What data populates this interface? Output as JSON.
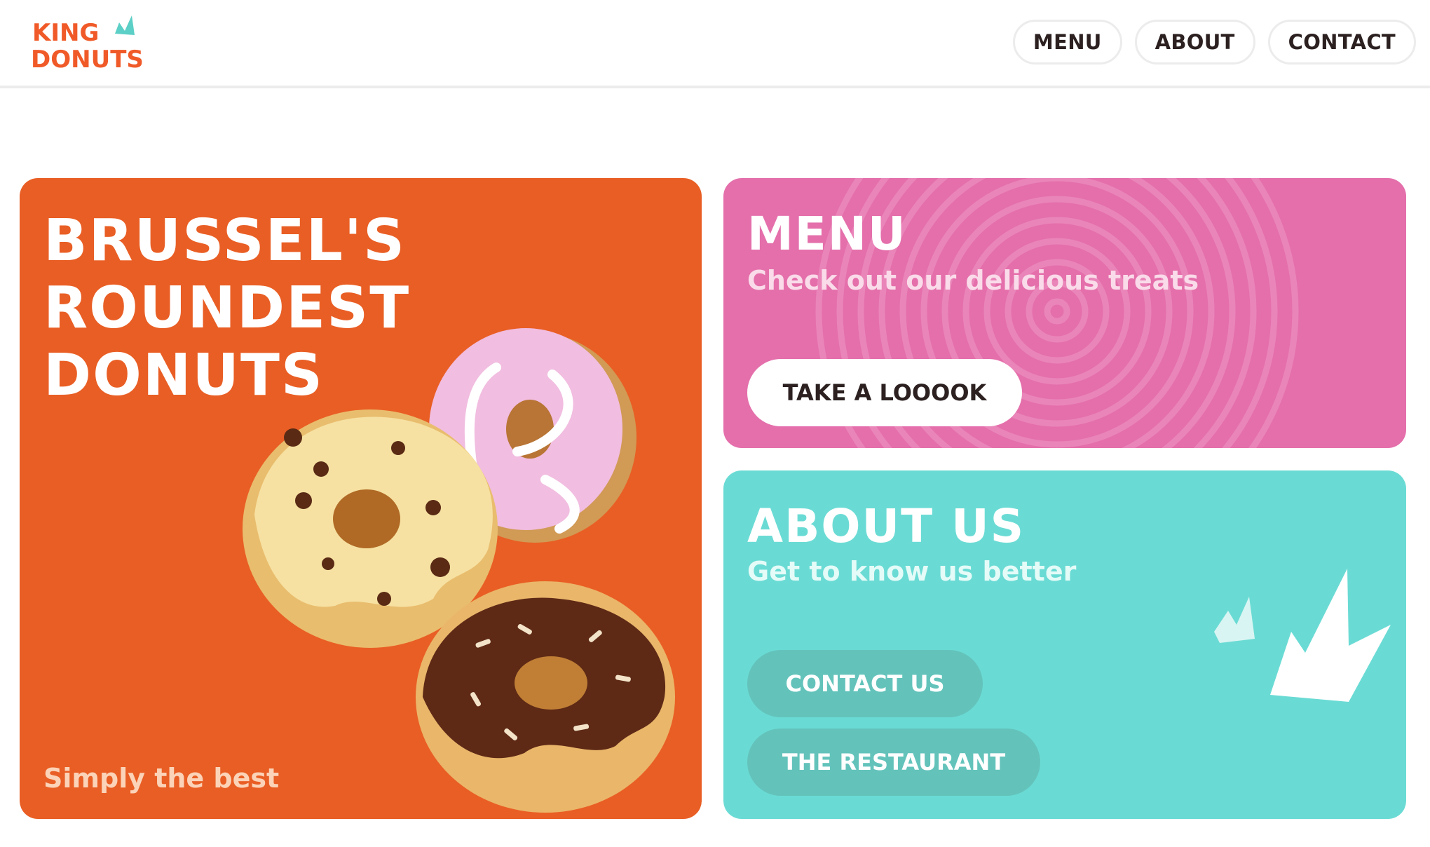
{
  "header": {
    "logo": {
      "line1": "KING",
      "line2": "DONUTS",
      "alt": "King Donuts"
    },
    "nav": [
      {
        "label": "MENU"
      },
      {
        "label": "ABOUT"
      },
      {
        "label": "CONTACT"
      }
    ]
  },
  "hero": {
    "title_lines": [
      "BRUSSEL'S",
      "ROUNDEST",
      "DONUTS"
    ],
    "tagline": "Simply the best",
    "image": "donuts-illustration"
  },
  "menu_card": {
    "title": "MENU",
    "subtitle": "Check out our delicious treats",
    "button_label": "TAKE A LOOOOK"
  },
  "about_card": {
    "title": "ABOUT US",
    "subtitle": "Get to know us better",
    "contact_label": "CONTACT US",
    "restaurant_label": "THE RESTAURANT"
  },
  "colors": {
    "brand_orange": "#e95e24",
    "menu_pink": "#e46fab",
    "about_teal": "#6adbd4",
    "logo_teal": "#5ccfc6"
  },
  "icons": [
    "crown-icon",
    "spiral-pattern"
  ]
}
